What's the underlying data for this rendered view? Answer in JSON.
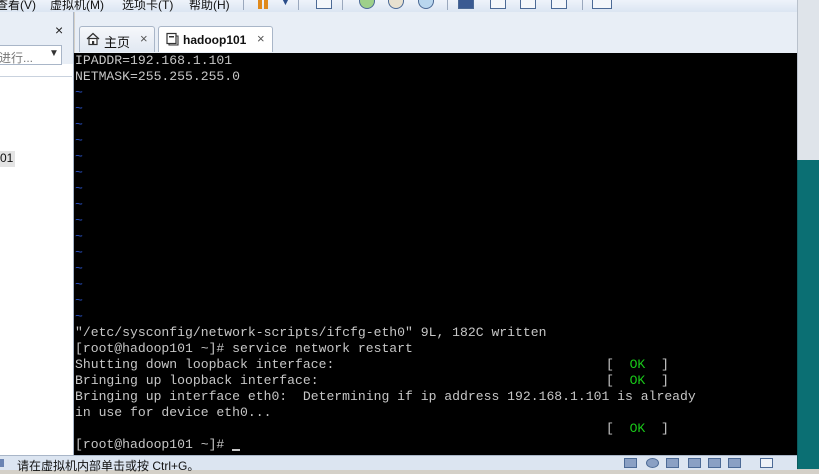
{
  "menubar": {
    "items": [
      "查看(V)",
      "虚拟机(M)",
      "选项卡(T)",
      "帮助(H)"
    ]
  },
  "toolbar": {
    "icons": [
      "pause-icon",
      "dropdown-caret-icon",
      "send-ctrl-alt-del-icon",
      "snapshot-icon",
      "revert-snapshot-icon",
      "snapshot-manager-icon",
      "view-console-icon",
      "fit-guest-icon",
      "full-screen-icon",
      "unity-icon",
      "thumbnail-icon"
    ]
  },
  "library": {
    "close_glyph": "×",
    "search_placeholder": "进行...",
    "vm_item": "01"
  },
  "tabs": [
    {
      "label": "主页",
      "icon": "home-icon",
      "close": "×"
    },
    {
      "label": "hadoop101",
      "icon": "vm-icon",
      "close": "×"
    }
  ],
  "terminal": {
    "lines": [
      "IPADDR=192.168.1.101",
      "NETMASK=255.255.255.0",
      "\"/etc/sysconfig/network-scripts/ifcfg-eth0\" 9L, 182C written",
      "[root@hadoop101 ~]# service network restart",
      "Shutting down loopback interface:",
      "Bringing up loopback interface:",
      "Bringing up interface eth0:  Determining if ip address 192.168.1.101 is already",
      "in use for device eth0...",
      "[root@hadoop101 ~]# "
    ],
    "tilde": "~",
    "ok_open": "[  ",
    "ok_word": "OK",
    "ok_close": "  ]"
  },
  "statusbar": {
    "text": "请在虚拟机内部单击或按 Ctrl+G。"
  },
  "colors": {
    "terminal_bg": "#000000",
    "terminal_fg": "#c6c6c6",
    "vim_tilde": "#2a52c8",
    "ok_green": "#19c819",
    "desktop_teal": "#0b6f73"
  }
}
